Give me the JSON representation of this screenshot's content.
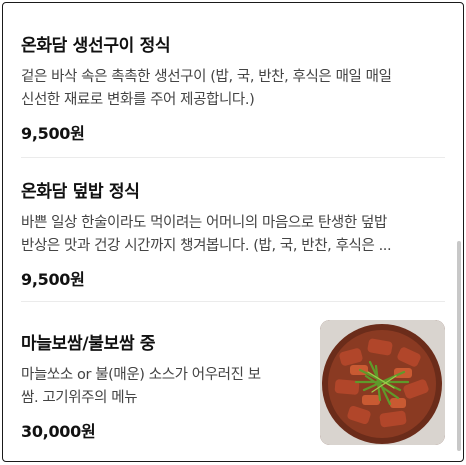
{
  "menu": {
    "items": [
      {
        "title": "온화담 생선구이 정식",
        "description_line1": "겉은 바삭 속은 촉촉한 생선구이 (밥, 국, 반찬, 후식은 매일 매일",
        "description_line2": "신선한 재료로 변화를 주어 제공합니다.)",
        "price": "9,500원"
      },
      {
        "title": "온화담 덮밥 정식",
        "description_line1": "바쁜 일상 한술이라도 먹이려는 어머니의 마음으로 탄생한 덮밥",
        "description_line2": "반상은 맛과 건강 시간까지 챙겨봅니다. (밥, 국, 반찬, 후식은 ...",
        "price": "9,500원"
      },
      {
        "title": "마늘보쌈/불보쌈 중",
        "description_line1": "마늘쏘소 or 불(매운) 소스가 어우러진 보",
        "description_line2": "쌈. 고기위주의 메뉴",
        "price": "30,000원",
        "image_icon": "bossam-photo"
      }
    ]
  }
}
